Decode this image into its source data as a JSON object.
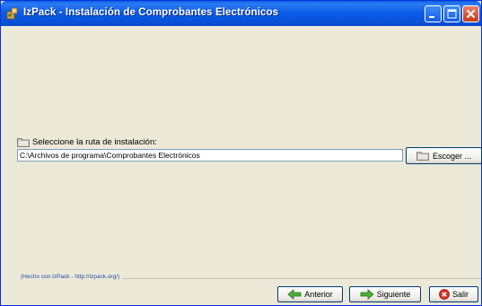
{
  "window": {
    "title": "IzPack - Instalación de Comprobantes Electrónicos",
    "icon": "izpack-app-icon",
    "controls": [
      "minimize-icon",
      "maximize-icon",
      "close-icon"
    ],
    "colors": {
      "titlebar": "#0A5FE8",
      "background": "#ECE9D8",
      "close": "#C53A19"
    }
  },
  "install_path": {
    "label": "Seleccione la ruta de instalación:",
    "value": "C:\\Archivos de programa\\Comprobantes Electrónicos",
    "browse_label": "Escoger ..."
  },
  "footer": {
    "credit": "(Hecho con IzPack - http://izpack.org/)",
    "previous_label": "Anterior",
    "next_label": "Siguiente",
    "quit_label": "Salir"
  }
}
